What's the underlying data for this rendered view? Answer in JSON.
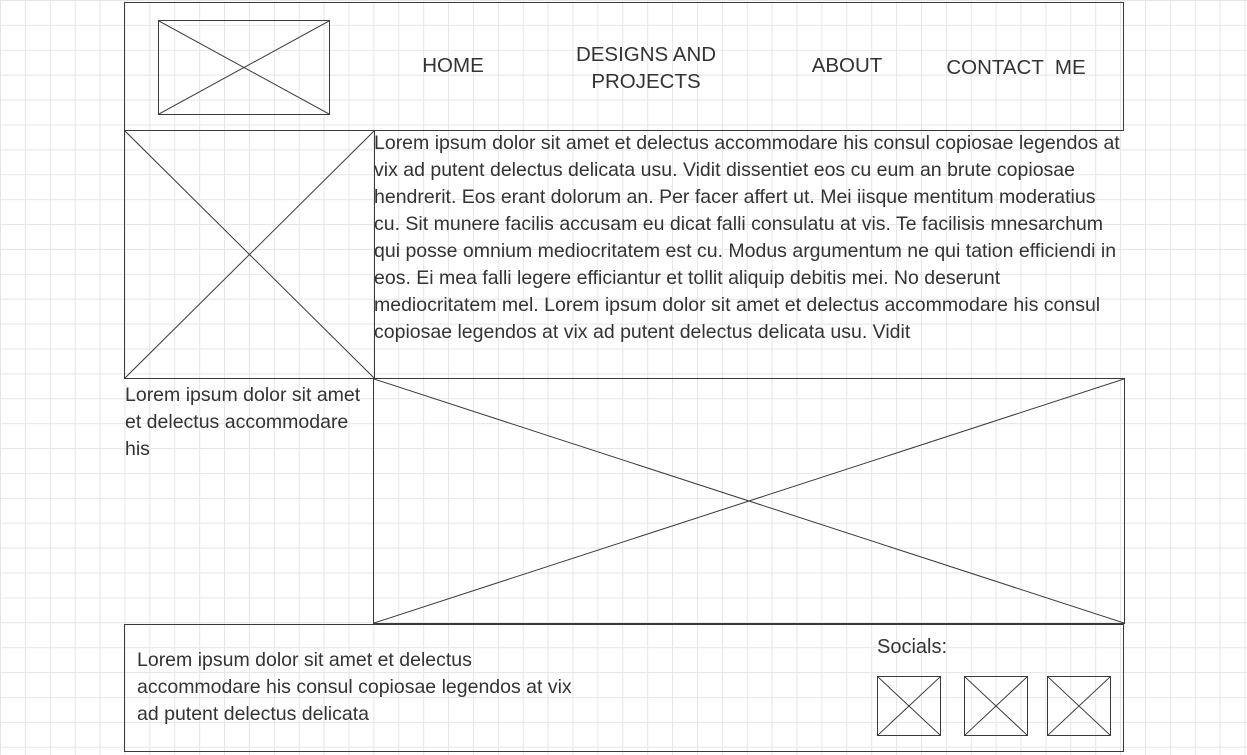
{
  "nav": {
    "home": "HOME",
    "designs_line1": "DESIGNS AND",
    "designs_line2": "PROJECTS",
    "about": "ABOUT",
    "contact": "CONTACT  ME"
  },
  "intro_text": "Lorem ipsum dolor sit amet et delectus accommodare his consul copiosae legendos at vix ad putent delectus delicata usu. Vidit dissentiet eos cu eum an brute copiosae hendrerit. Eos erant dolorum an. Per facer affert ut. Mei iisque mentitum moderatius cu. Sit munere facilis accusam eu dicat falli consulatu at vis. Te facilisis mnesarchum qui posse omnium mediocritatem est cu. Modus argumentum ne qui tation efficiendi in eos. Ei mea falli legere efficiantur et tollit aliquip debitis mei. No deserunt mediocritatem mel. Lorem ipsum dolor sit amet et delectus accommodare his consul copiosae legendos at vix ad putent delectus delicata usu. Vidit",
  "side_caption": "Lorem ipsum dolor sit amet et delectus accommodare his",
  "footer": {
    "text": "Lorem ipsum dolor sit amet et delectus accommodare his consul copiosae legendos at vix ad putent delectus delicata",
    "socials_label": "Socials:"
  },
  "colors": {
    "line": "#3a3a3a",
    "text": "#333333",
    "grid": "#e6e6e6",
    "background": "#ffffff"
  }
}
